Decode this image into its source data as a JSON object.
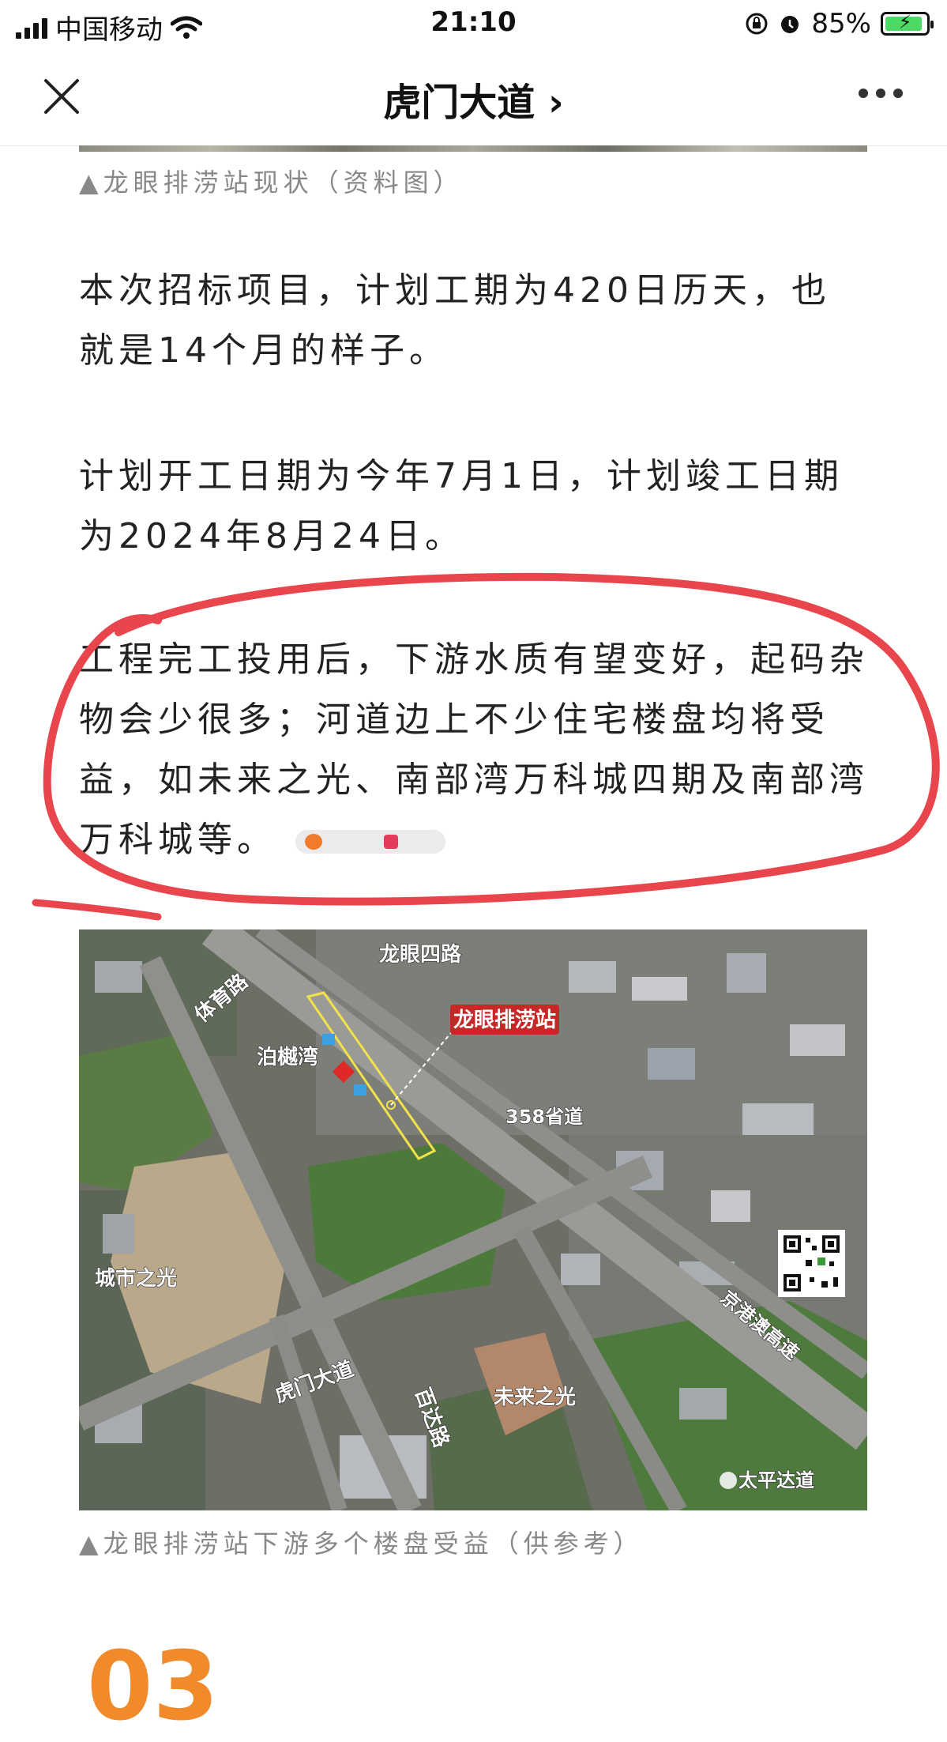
{
  "status_bar": {
    "carrier": "中国移动",
    "time": "21:10",
    "battery_percent": "85%"
  },
  "nav": {
    "title": "虎门大道 ›",
    "close_icon": "close-icon",
    "more_icon": "more-icon"
  },
  "article": {
    "caption_top": "▲龙眼排涝站现状（资料图）",
    "paragraphs": [
      "本次招标项目，计划工期为420日历天，也就是14个月的样子。",
      "计划开工日期为今年7月1日，计划竣工日期为2024年8月24日。",
      "工程完工投用后，下游水质有望变好，起码杂物会少很多；河道边上不少住宅楼盘均将受益，如未来之光、南部湾万科城四期及南部湾万科城等。"
    ],
    "map_labels": {
      "road_1": "龙眼四路",
      "road_2": "体育路",
      "station": "龙眼排涝站",
      "place_1": "泊樾湾",
      "road_3": "358省道",
      "place_2": "城市之光",
      "road_4": "虎门大道",
      "road_5": "百达路",
      "place_3": "未来之光",
      "road_6": "京港澳高速",
      "watermark": "太平达道"
    },
    "caption_bottom": "▲龙眼排涝站下游多个楼盘受益（供参考）",
    "section_number": "03"
  },
  "colors": {
    "annotation_red": "#e8454c",
    "section_orange": "#f08a2a",
    "battery_green": "#4cd964"
  }
}
